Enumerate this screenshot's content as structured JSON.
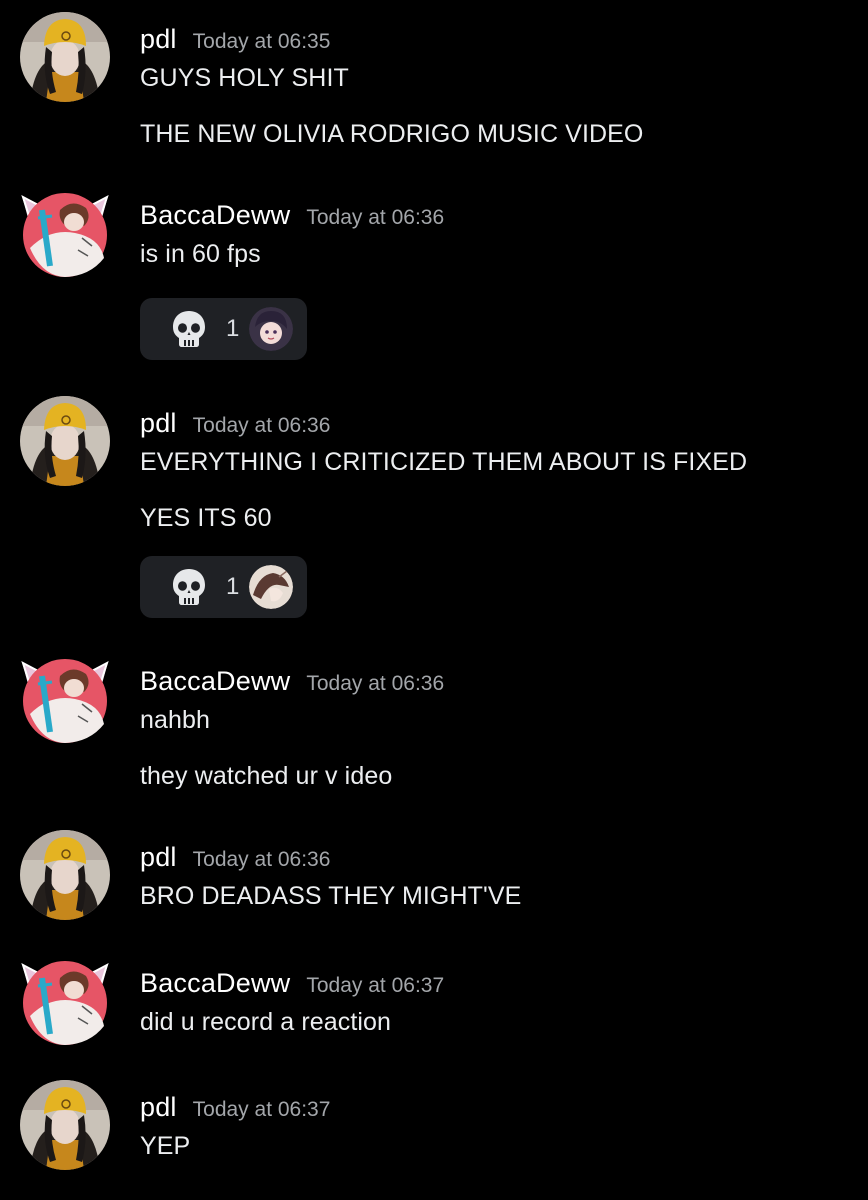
{
  "colors": {
    "background": "#000000",
    "username": "#ffffff",
    "timestamp": "#a3a6aa",
    "message_text": "#eceef0",
    "reaction_bg": "#1f2125"
  },
  "messages": [
    {
      "author": "pdl",
      "timestamp": "Today at 06:35",
      "avatar_icon": "pdl-avatar-icon",
      "lines": [
        "GUYS HOLY SHIT",
        "THE NEW OLIVIA RODRIGO MUSIC VIDEO"
      ]
    },
    {
      "author": "BaccaDeww",
      "timestamp": "Today at 06:36",
      "avatar_icon": "baccadeww-avatar-icon",
      "lines": [
        "is in 60 fps"
      ],
      "reaction": {
        "emoji_icon": "skull-icon",
        "count": "1"
      }
    },
    {
      "author": "pdl",
      "timestamp": "Today at 06:36",
      "avatar_icon": "pdl-avatar-icon",
      "lines": [
        "EVERYTHING I CRITICIZED THEM ABOUT IS FIXED",
        "YES ITS 60"
      ],
      "reaction": {
        "emoji_icon": "skull-icon",
        "count": "1"
      }
    },
    {
      "author": "BaccaDeww",
      "timestamp": "Today at 06:36",
      "avatar_icon": "baccadeww-avatar-icon",
      "lines": [
        "nahbh",
        "they watched ur v ideo"
      ]
    },
    {
      "author": "pdl",
      "timestamp": "Today at 06:36",
      "avatar_icon": "pdl-avatar-icon",
      "lines": [
        "BRO DEADASS THEY MIGHT'VE"
      ]
    },
    {
      "author": "BaccaDeww",
      "timestamp": "Today at 06:37",
      "avatar_icon": "baccadeww-avatar-icon",
      "lines": [
        "did u record a reaction"
      ]
    },
    {
      "author": "pdl",
      "timestamp": "Today at 06:37",
      "avatar_icon": "pdl-avatar-icon",
      "lines": [
        "YEP"
      ]
    }
  ]
}
